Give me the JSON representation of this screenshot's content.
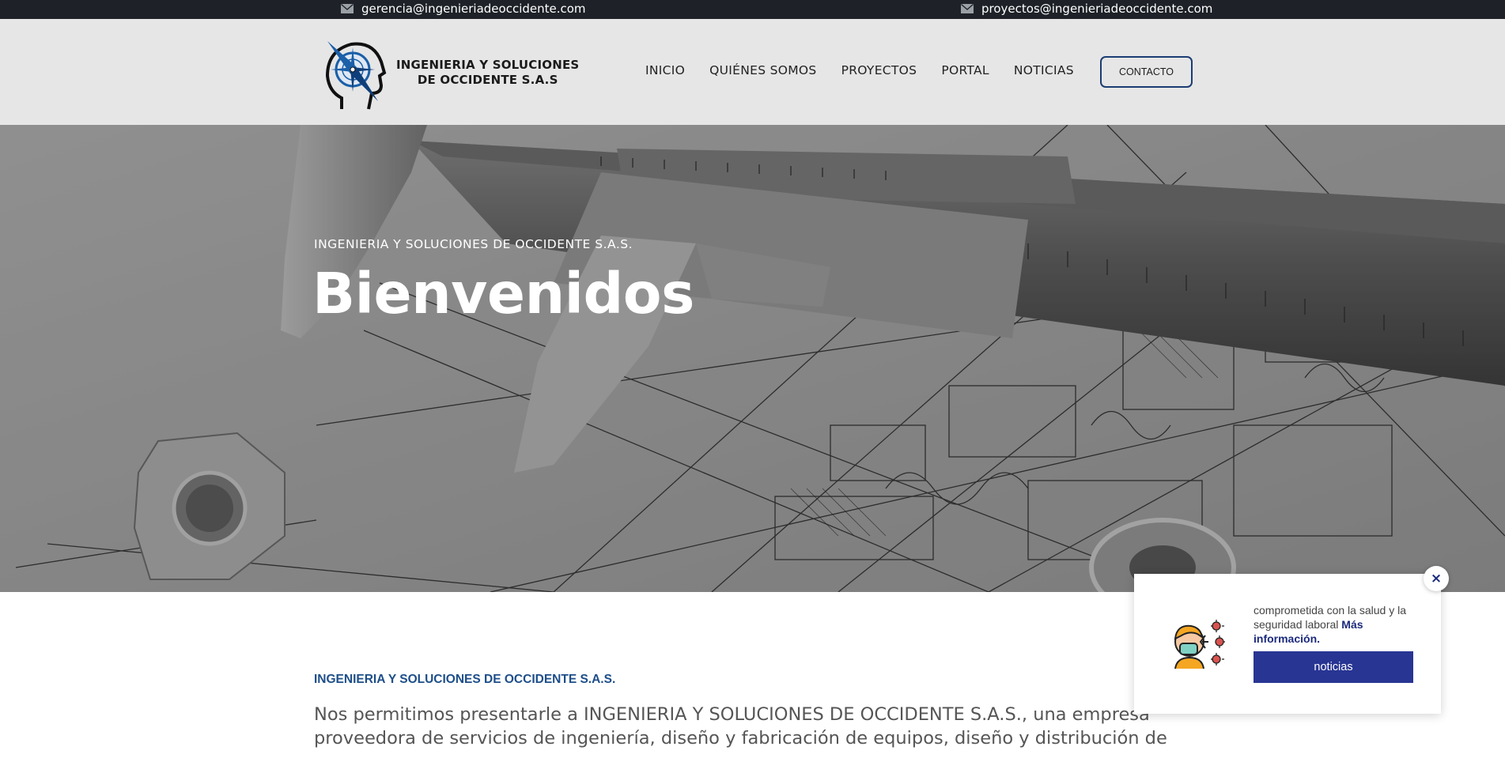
{
  "topbar": {
    "email_left": "gerencia@ingenieriadeoccidente.com",
    "email_right": "proyectos@ingenieriadeoccidente.com"
  },
  "header": {
    "logo_line1": "INGENIERIA Y SOLUCIONES",
    "logo_line2": "DE OCCIDENTE S.A.S",
    "nav": [
      "INICIO",
      "QUIÉNES SOMOS",
      "PROYECTOS",
      "PORTAL",
      "NOTICIAS"
    ],
    "cta_label": "CONTACTO"
  },
  "hero": {
    "subtitle": "INGENIERIA Y SOLUCIONES DE OCCIDENTE S.A.S.",
    "title": "Bienvenidos"
  },
  "content": {
    "section_label": "INGENIERIA Y SOLUCIONES DE OCCIDENTE S.A.S.",
    "intro": "Nos permitimos presentarle a INGENIERIA Y SOLUCIONES DE OCCIDENTE S.A.S., una empresa proveedora de servicios de ingeniería, diseño y fabricación de equipos, diseño y distribución de"
  },
  "popup": {
    "text": "comprometida con la salud y la seguridad laboral",
    "more_link": "Más información.",
    "button_label": "noticias",
    "close_symbol": "×"
  },
  "colors": {
    "topbar_bg": "#1e2228",
    "header_bg": "#e6e6e6",
    "accent_blue": "#1d4e89",
    "popup_button": "#283593"
  },
  "icons": [
    "envelope-icon",
    "compass-head-logo",
    "close-icon",
    "doctor-mask-virus-illustration"
  ]
}
